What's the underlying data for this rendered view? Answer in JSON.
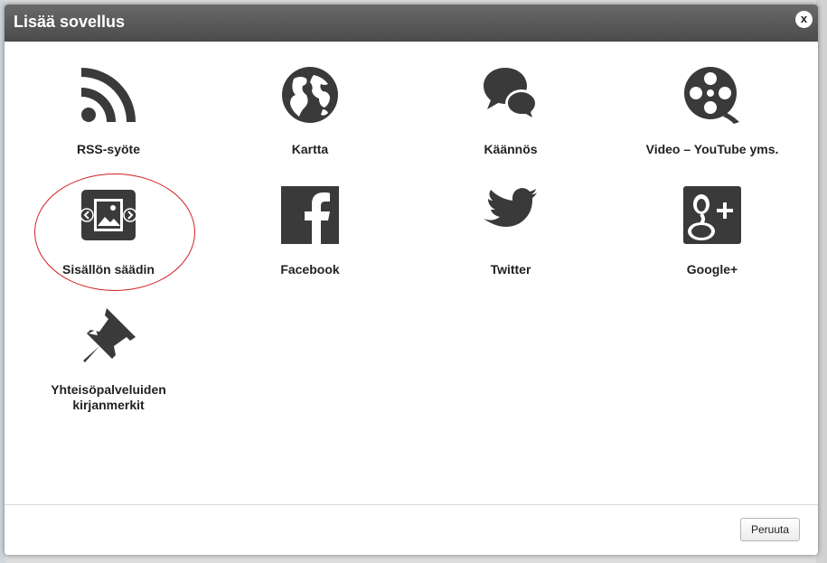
{
  "dialog": {
    "title": "Lisää sovellus",
    "close_label": "x",
    "cancel_label": "Peruuta"
  },
  "apps": [
    {
      "label": "RSS-syöte",
      "icon": "rss-icon"
    },
    {
      "label": "Kartta",
      "icon": "globe-icon"
    },
    {
      "label": "Käännös",
      "icon": "speech-bubbles-icon"
    },
    {
      "label": "Video – YouTube yms.",
      "icon": "film-reel-icon"
    },
    {
      "label": "Sisällön säädin",
      "icon": "image-slider-icon",
      "highlighted": true
    },
    {
      "label": "Facebook",
      "icon": "facebook-icon"
    },
    {
      "label": "Twitter",
      "icon": "twitter-bird-icon"
    },
    {
      "label": "Google+",
      "icon": "google-plus-icon"
    },
    {
      "label": "Yhteisöpalveluiden kirjanmerkit",
      "icon": "pushpin-icon"
    }
  ],
  "colors": {
    "icon": "#3a3a3a",
    "header": "#555555",
    "highlight": "#d21e1e"
  }
}
